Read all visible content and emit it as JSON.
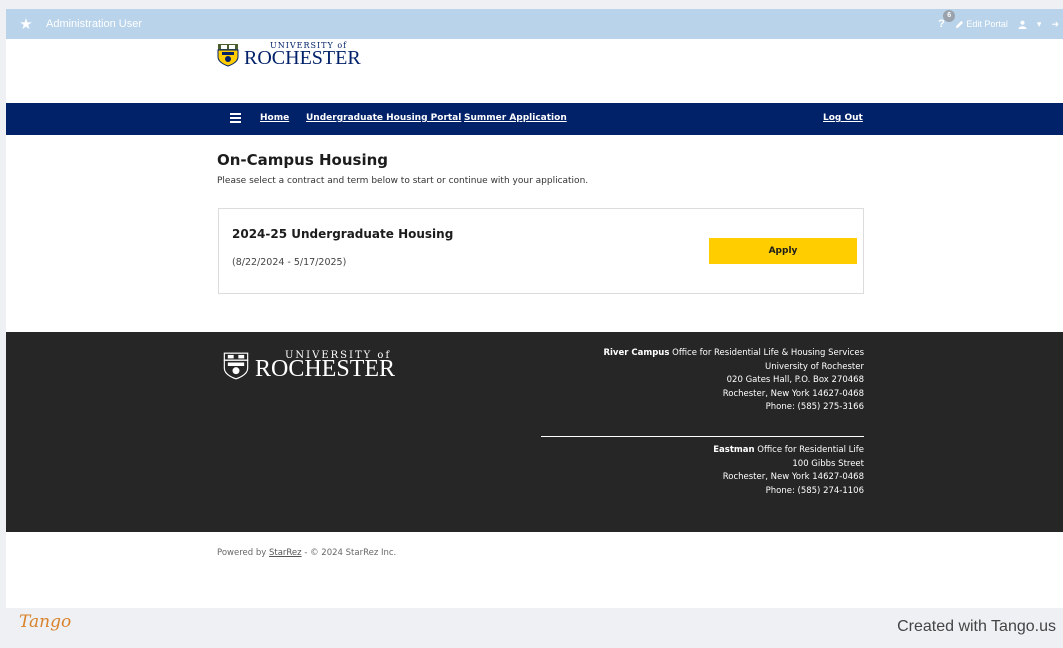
{
  "adminbar": {
    "star_icon": "star-icon",
    "user": "Administration User",
    "help_icon": "?",
    "notification_count": "6",
    "edit_label": "Edit Portal",
    "person_icon": "person-icon",
    "caret_icon": "chevron-down-icon"
  },
  "header": {
    "logo_univ": "UNIVERSITY of",
    "logo_name": "ROCHESTER"
  },
  "nav": {
    "items": [
      "Home",
      "Undergraduate Housing Portal",
      "Summer Application"
    ],
    "logout": "Log Out"
  },
  "main": {
    "title": "On-Campus Housing",
    "subtitle": "Please select a contract and term below to start or continue with your application.",
    "card": {
      "title": "2024-25 Undergraduate Housing",
      "dates": "(8/22/2024 - 5/17/2025)",
      "button": "Apply"
    }
  },
  "footer": {
    "logo_univ": "UNIVERSITY of",
    "logo_name": "ROCHESTER",
    "river": {
      "campus": "River Campus",
      "office": " Office for Residential Life & Housing Services",
      "line2": "University of Rochester",
      "line3": "020 Gates Hall, P.O. Box 270468",
      "line4": "Rochester, New York 14627-0468",
      "line5": "Phone: (585) 275-3166"
    },
    "eastman": {
      "campus": "Eastman",
      "office": " Office for Residential Life",
      "line2": "100 Gibbs Street",
      "line3": "Rochester, New York 14627-0468",
      "line4": "Phone: (585) 274-1106"
    }
  },
  "powered": {
    "prefix": "Powered by ",
    "link": "StarRez",
    "suffix": " - © 2024 StarRez Inc."
  },
  "tango": {
    "logo": "Tango",
    "credit": "Created with Tango.us"
  },
  "colors": {
    "nav": "#012169",
    "apply": "#ffcd00",
    "footer": "#262626",
    "adminbar": "#b8d3ea"
  }
}
